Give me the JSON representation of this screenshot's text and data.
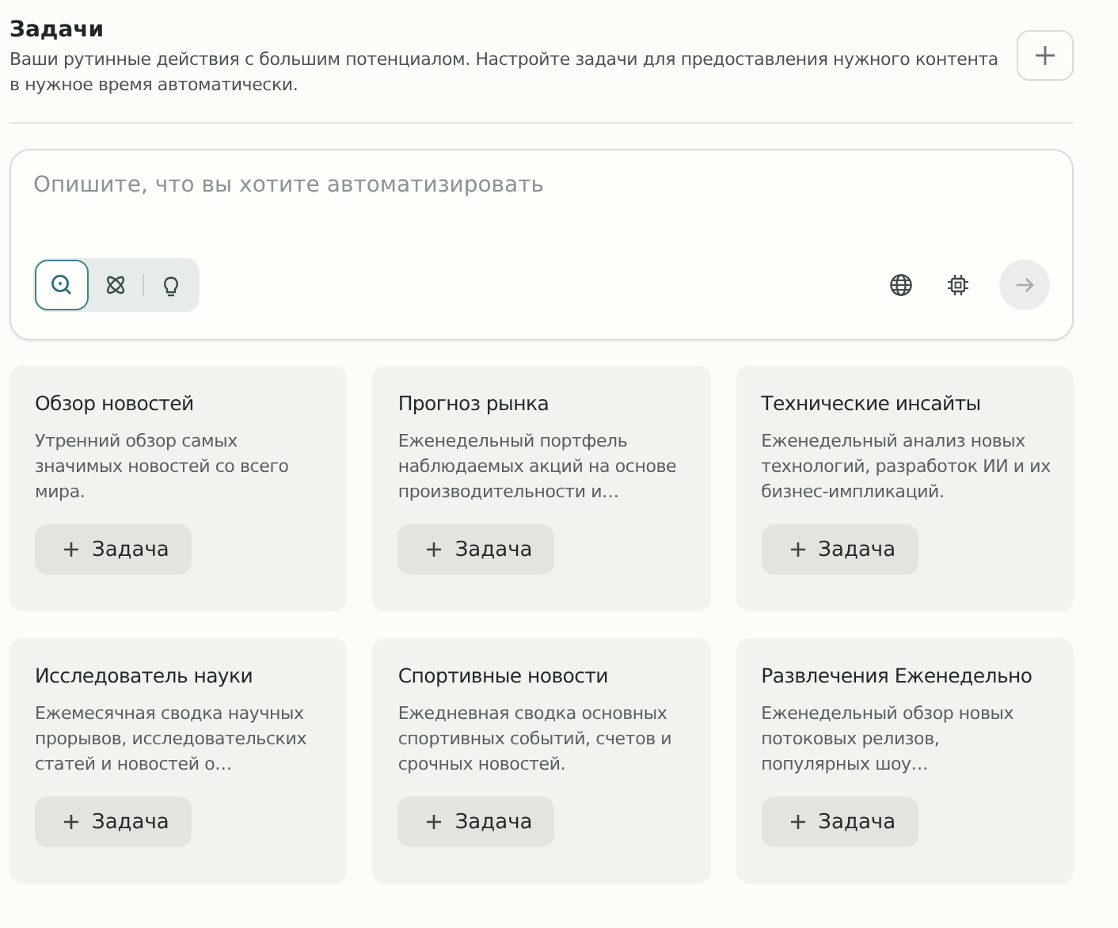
{
  "header": {
    "title": "Задачи",
    "subtitle": "Ваши рутинные действия с большим потенциалом. Настройте задачи для предоставления нужного контента в нужное время автоматически."
  },
  "prompt": {
    "placeholder": "Опишите, что вы хотите автоматизировать",
    "modes": [
      {
        "kind": "search",
        "selected": true
      },
      {
        "kind": "atom",
        "selected": false
      },
      {
        "kind": "bulb",
        "selected": false
      }
    ]
  },
  "cards": [
    {
      "title": "Обзор новостей",
      "description": "Утренний обзор самых значимых новостей со всего мира.",
      "button": "Задача"
    },
    {
      "title": "Прогноз рынка",
      "description": "Еженедельный портфель наблюдаемых акций на основе производительности и…",
      "button": "Задача"
    },
    {
      "title": "Технические инсайты",
      "description": "Еженедельный анализ новых технологий, разработок ИИ и их бизнес-импликаций.",
      "button": "Задача"
    },
    {
      "title": "Исследователь науки",
      "description": "Ежемесячная сводка научных прорывов, исследовательских статей и новостей о…",
      "button": "Задача"
    },
    {
      "title": "Спортивные новости",
      "description": "Ежедневная сводка основных спортивных событий, счетов и срочных новостей.",
      "button": "Задача"
    },
    {
      "title": "Развлечения Еженедельно",
      "description": "Еженедельный обзор новых потоковых релизов, популярных шоу…",
      "button": "Задача"
    }
  ]
}
